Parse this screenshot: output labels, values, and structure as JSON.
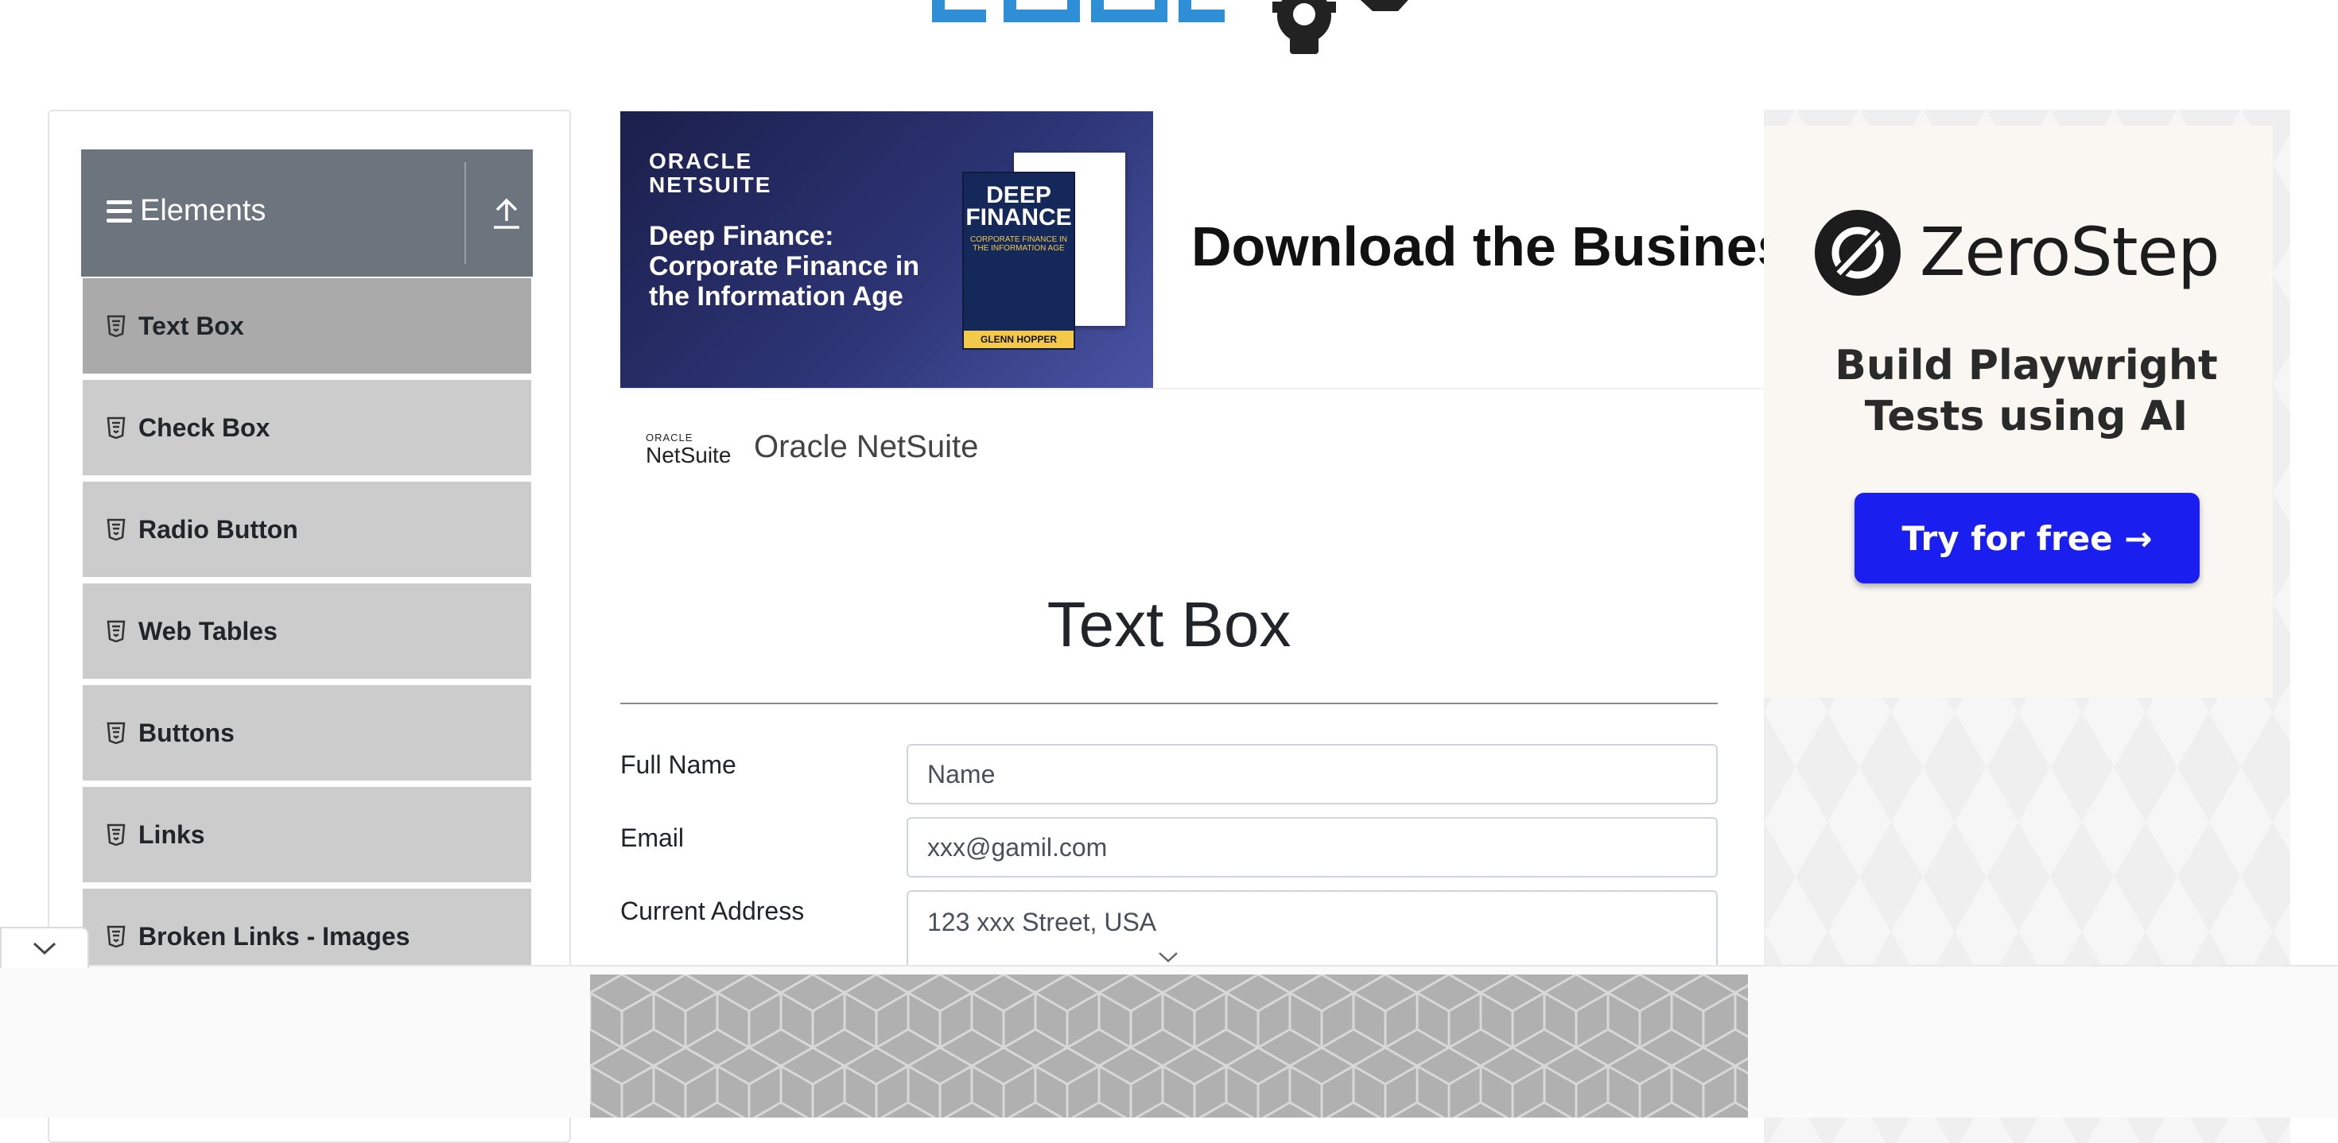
{
  "header": {
    "logo_text": "TOOLSQA"
  },
  "sidebar": {
    "group_title": "Elements",
    "items": [
      {
        "label": "Text Box",
        "active": true
      },
      {
        "label": "Check Box",
        "active": false
      },
      {
        "label": "Radio Button",
        "active": false
      },
      {
        "label": "Web Tables",
        "active": false
      },
      {
        "label": "Buttons",
        "active": false
      },
      {
        "label": "Links",
        "active": false
      },
      {
        "label": "Broken Links - Images",
        "active": false
      }
    ]
  },
  "ad_banner": {
    "brand_top": "ORACLE",
    "brand_bottom": "NETSUITE",
    "headline": "Deep Finance: Corporate Finance in the Information Age",
    "book_title": "DEEP FINANCE",
    "book_subtitle": "CORPORATE FINANCE IN THE INFORMATION AGE",
    "book_author": "GLENN HOPPER",
    "title": "Download the Business",
    "advertiser_logo_top": "ORACLE",
    "advertiser_logo_bottom": "NetSuite",
    "advertiser_name": "Oracle NetSuite"
  },
  "main": {
    "page_title": "Text Box",
    "form": {
      "full_name_label": "Full Name",
      "full_name_placeholder": "Name",
      "email_label": "Email",
      "email_placeholder": "xxx@gamil.com",
      "address_label": "Current Address",
      "address_placeholder": "123 xxx Street, USA"
    }
  },
  "right_ad": {
    "brand": "ZeroStep",
    "tagline": "Build Playwright Tests using AI",
    "cta": "Try for free →"
  },
  "colors": {
    "sidebar_header": "#6c757d",
    "sidebar_item": "#cccccc",
    "sidebar_item_active": "#aaaaaa",
    "toolsqa_blue": "#2e8fd6",
    "cta_blue": "#1a1ff0"
  }
}
